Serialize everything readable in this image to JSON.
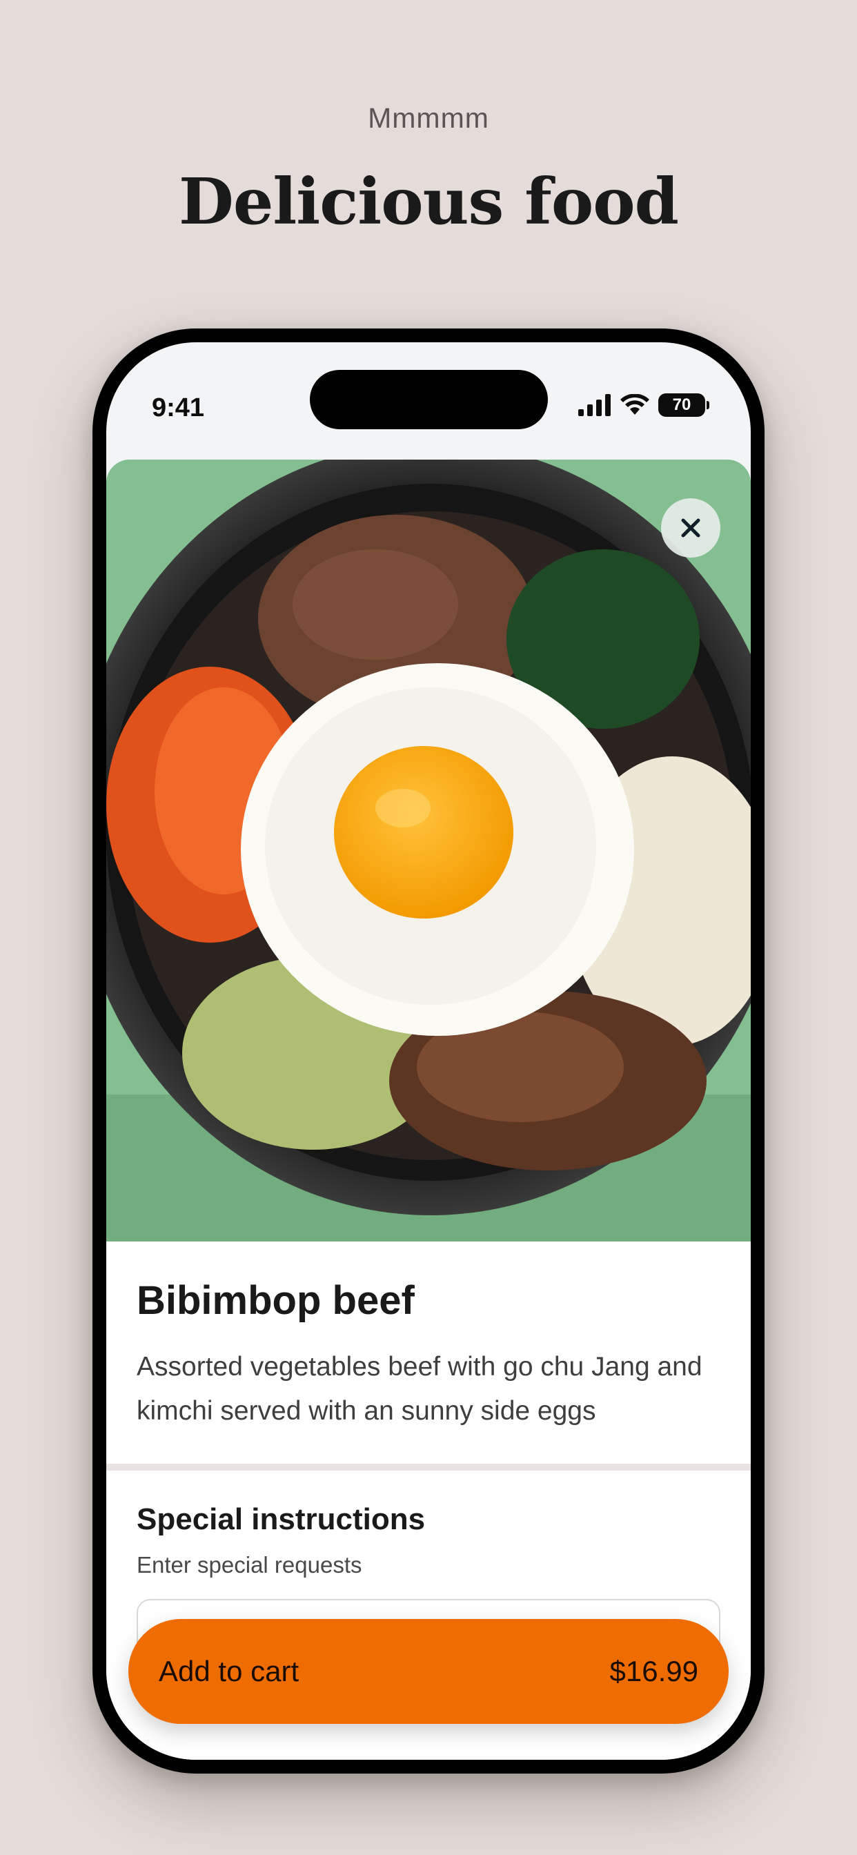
{
  "header": {
    "eyebrow": "Mmmmm",
    "title": "Delicious food"
  },
  "status_bar": {
    "time": "9:41",
    "battery": "70"
  },
  "item": {
    "name": "Bibimbop beef",
    "description": "Assorted vegetables beef with go chu Jang and kimchi served with an sunny side eggs"
  },
  "special_instructions": {
    "title": "Special instructions",
    "subtitle": "Enter special requests",
    "value": ""
  },
  "cart_button": {
    "label": "Add to cart",
    "price": "$16.99"
  },
  "icons": [
    "signal-icon",
    "wifi-icon",
    "battery-icon",
    "close-icon"
  ],
  "colors": {
    "accent": "#ee6c00",
    "background": "#e4dcd9"
  }
}
